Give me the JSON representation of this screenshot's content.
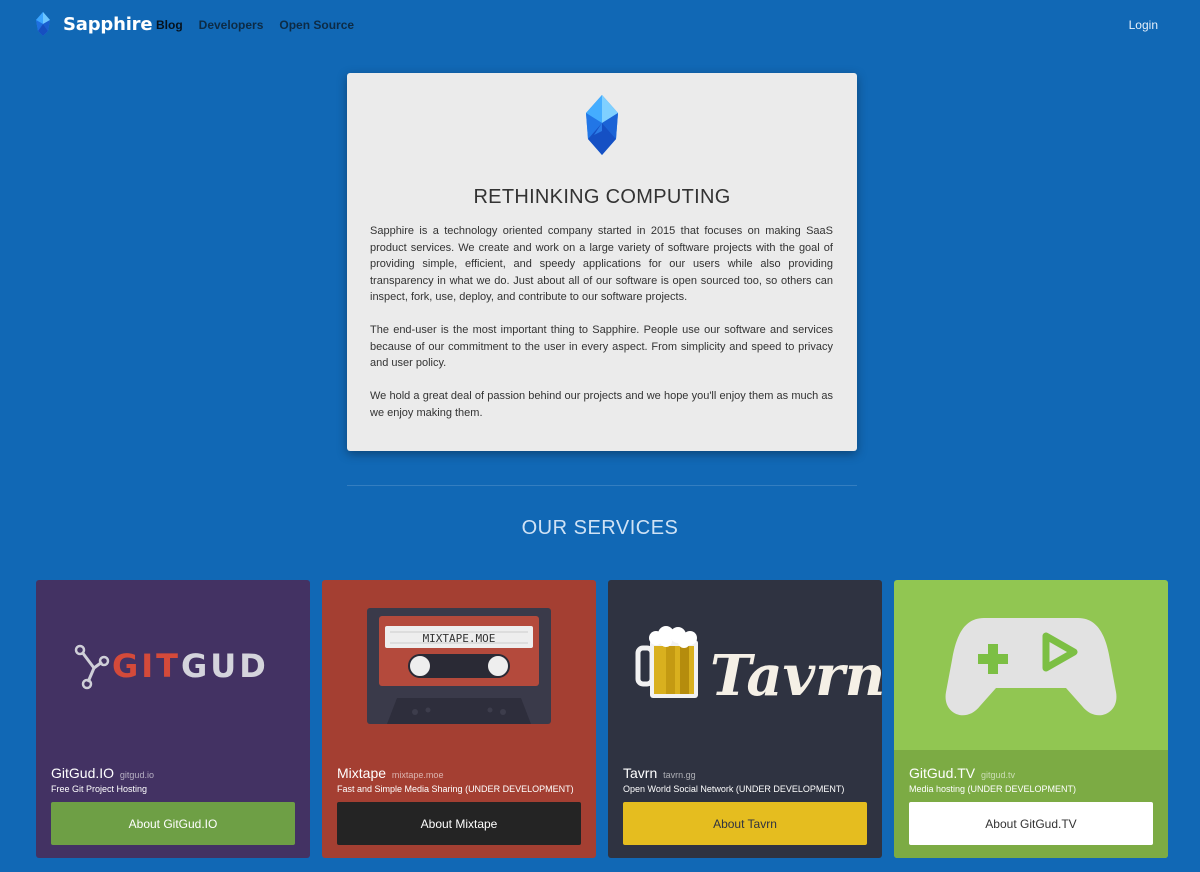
{
  "nav": {
    "brand": "Sapphire",
    "links": [
      "Blog",
      "Developers",
      "Open Source"
    ],
    "login": "Login"
  },
  "about": {
    "title": "RETHINKING COMPUTING",
    "paragraphs": [
      "Sapphire is a technology oriented company started in 2015 that focuses on making SaaS product services. We create and work on a large variety of software projects with the goal of providing simple, efficient, and speedy applications for our users while also providing transparency in what we do. Just about all of our software is open sourced too, so others can inspect, fork, use, deploy, and contribute to our software projects.",
      "The end-user is the most important thing to Sapphire. People use our software and services because of our commitment to the user in every aspect. From simplicity and speed to privacy and user policy.",
      "We hold a great deal of passion behind our projects and we hope you'll enjoy them as much as we enjoy making them."
    ]
  },
  "services_title": "OUR SERVICES",
  "services": [
    {
      "name": "GitGud.IO",
      "domain": "gitgud.io",
      "description": "Free Git Project Hosting",
      "button": "About GitGud.IO",
      "logo_text": "GITGUD",
      "bg": "#433263",
      "button_bg": "#6e9f45",
      "button_fg": "#ffffff"
    },
    {
      "name": "Mixtape",
      "domain": "mixtape.moe",
      "description": "Fast and Simple Media Sharing (UNDER DEVELOPMENT)",
      "button": "About Mixtape",
      "logo_text": "MIXTAPE.MOE",
      "bg": "#a43f32",
      "button_bg": "#242424",
      "button_fg": "#ffffff"
    },
    {
      "name": "Tavrn",
      "domain": "tavrn.gg",
      "description": "Open World Social Network (UNDER DEVELOPMENT)",
      "button": "About Tavrn",
      "logo_text": "Tavrn",
      "bg": "#2f3341",
      "button_bg": "#e5bd1f",
      "button_fg": "#2f3341"
    },
    {
      "name": "GitGud.TV",
      "domain": "gitgud.tv",
      "description": "Media hosting (UNDER DEVELOPMENT)",
      "button": "About GitGud.TV",
      "bg": "#91c652",
      "button_bg": "#ffffff",
      "button_fg": "#333333"
    }
  ],
  "colors": {
    "page_bg": "#1168b5",
    "card_bg": "#ebebeb",
    "gem_light": "#5fc0ff",
    "gem_dark": "#1a5fe0"
  }
}
